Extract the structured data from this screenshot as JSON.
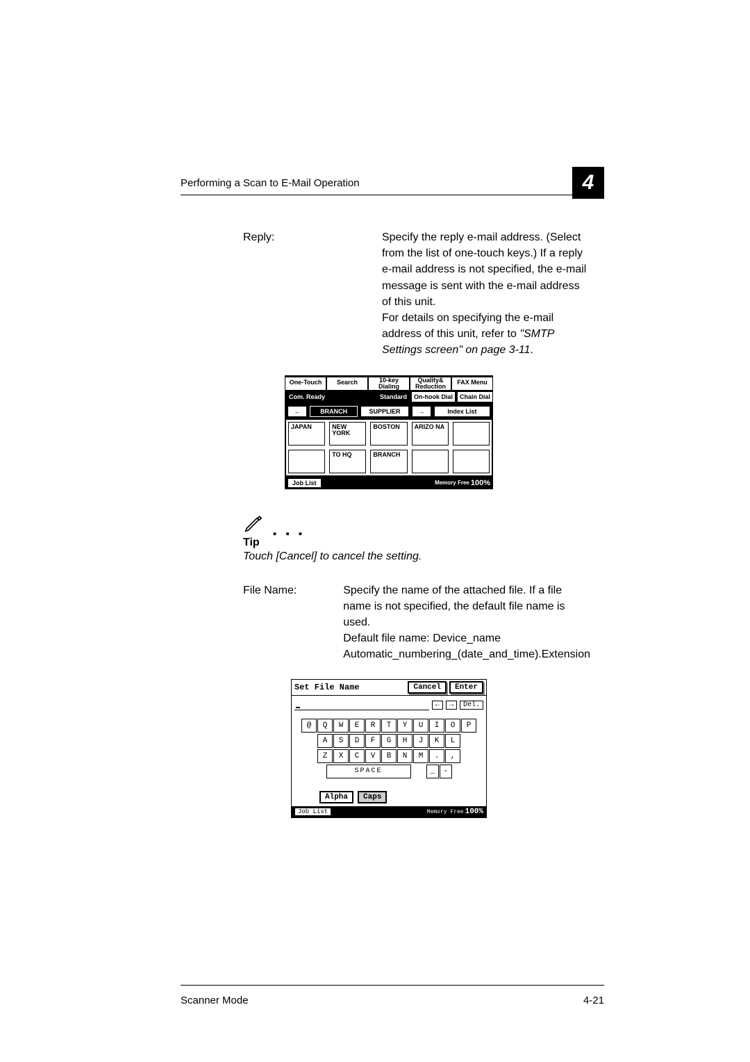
{
  "header": {
    "running": "Performing a Scan to E-Mail Operation",
    "chapter": "4"
  },
  "reply": {
    "term": "Reply:",
    "body1": "Specify the reply e-mail address. (Select from the list of one-touch keys.) If a reply e-mail address is not specified, the e-mail message is sent with the e-mail address of this unit.",
    "body2": "For details on specifying the e-mail address of this unit, refer to ",
    "body2_italic": "\"SMTP Settings screen\" on page 3-11",
    "body2_end": "."
  },
  "panel1": {
    "tabs": [
      "One-Touch",
      "Search",
      "10-key Dialing",
      "Quality& Reduction",
      "FAX Menu"
    ],
    "status": "Com. Ready",
    "segs": [
      "Standard",
      "On-hook Dial",
      "Chain Dial"
    ],
    "mid": {
      "arrow_l": "←",
      "branch": "BRANCH",
      "supplier": "SUPPLIER",
      "arrow_r": "→",
      "index": "Index List"
    },
    "grid": [
      [
        "JAPAN",
        "NEW YORK",
        "BOSTON",
        "ARIZO NA",
        ""
      ],
      [
        "",
        "TO HQ",
        "BRANCH",
        "",
        ""
      ]
    ],
    "joblist": "Job List",
    "memory_lbl": "Memory Free",
    "memory_val": "100%"
  },
  "tip": {
    "dots": ". . .",
    "label": "Tip",
    "text": "Touch [Cancel] to cancel the setting."
  },
  "filename": {
    "term": "File Name:",
    "body1": "Specify the name of the attached file. If a file name is not specified, the default file name is used.",
    "body2": "Default file name: Device_name Automatic_numbering_(date_and_time).Extension"
  },
  "panel2": {
    "title": "Set File Name",
    "cancel": "Cancel",
    "enter": "Enter",
    "arrow_l": "←",
    "arrow_r": "→",
    "del": "Del.",
    "rows": [
      [
        "@",
        "Q",
        "W",
        "E",
        "R",
        "T",
        "Y",
        "U",
        "I",
        "O",
        "P"
      ],
      [
        "A",
        "S",
        "D",
        "F",
        "G",
        "H",
        "J",
        "K",
        "L"
      ],
      [
        "Z",
        "X",
        "C",
        "V",
        "B",
        "N",
        "M",
        ".",
        ","
      ]
    ],
    "space": "SPACE",
    "underscore": "_",
    "dash": "-",
    "alpha": "Alpha",
    "caps": "Caps",
    "joblist": "Job List",
    "memory_lbl": "Memory Free",
    "memory_val": "100%"
  },
  "footer": {
    "left": "Scanner Mode",
    "right": "4-21"
  }
}
